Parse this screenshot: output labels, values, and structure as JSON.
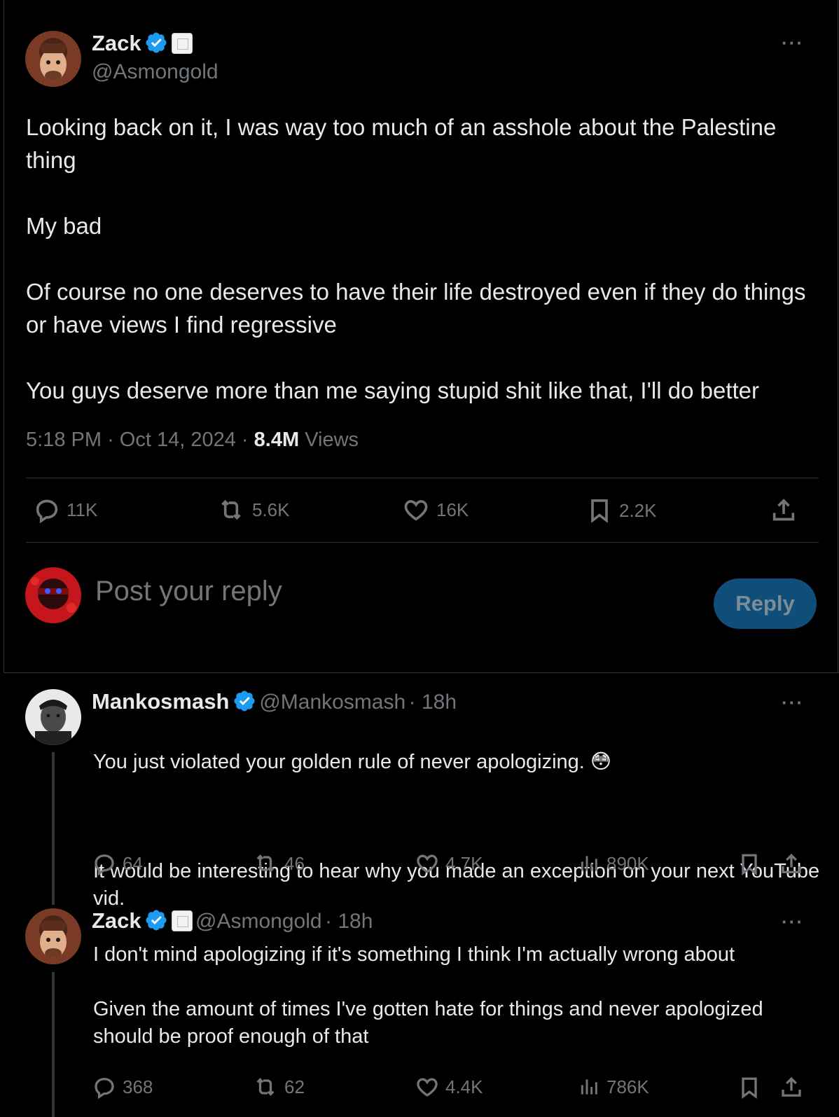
{
  "post": {
    "author_name": "Zack",
    "author_handle": "@Asmongold",
    "more": "···",
    "text": "Looking back on it, I was way too much of an asshole about the Palestine thing\n\nMy bad\n\nOf course no one deserves to have their life destroyed even if they do things or have views I find regressive\n\nYou guys deserve more than me saying stupid shit like that, I'll do better",
    "time": "5:18 PM",
    "date": "Oct 14, 2024",
    "views_count": "8.4M",
    "views_label": "Views",
    "dot": "·",
    "stats": {
      "replies": "11K",
      "reposts": "5.6K",
      "likes": "16K",
      "bookmarks": "2.2K"
    }
  },
  "composer": {
    "placeholder": "Post your reply",
    "button": "Reply"
  },
  "replies": [
    {
      "author_name": "Mankosmash",
      "author_handle": "@Mankosmash",
      "age": "· 18h",
      "more": "···",
      "text_line1": "You just violated your golden rule of never apologizing. 😳",
      "text_rest": "It would be interesting to hear why you made an exception on your next YouTube vid.",
      "stats": {
        "replies": "64",
        "reposts": "46",
        "likes": "4.7K",
        "views": "890K"
      }
    },
    {
      "author_name": "Zack",
      "author_handle": "@Asmongold",
      "age": "· 18h",
      "more": "···",
      "text": "I don't mind apologizing if it's something I think I'm actually wrong about\n\nGiven the amount of times I've gotten hate for things and never apologized should be proof enough of that",
      "stats": {
        "replies": "368",
        "reposts": "62",
        "likes": "4.4K",
        "views": "786K"
      }
    }
  ],
  "colors": {
    "background": "#000000",
    "text": "#e7e9ea",
    "muted": "#71767b",
    "verified": "#1d9bf0",
    "reply_button": "#0f4e78"
  },
  "icons": [
    "verified-badge-icon",
    "comment-icon",
    "repost-icon",
    "heart-icon",
    "bookmark-icon",
    "share-icon",
    "views-icon",
    "more-icon"
  ]
}
